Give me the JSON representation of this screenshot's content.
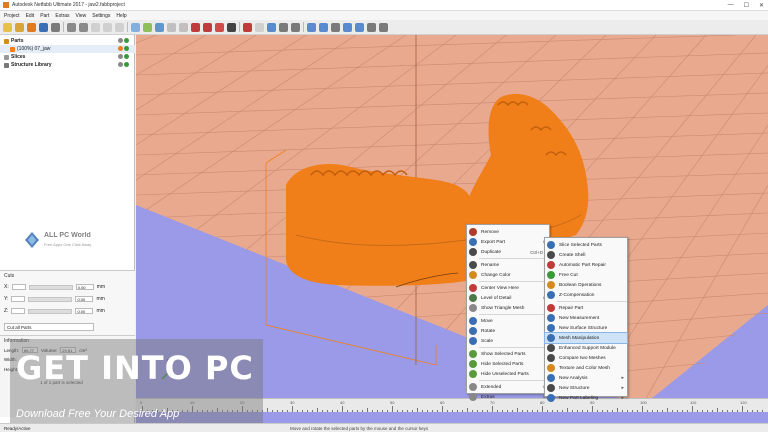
{
  "window": {
    "title": "Autodesk Netfabb Ultimate 2017 - jaw2.fabbproject",
    "controls": [
      "—",
      "☐",
      "✕"
    ]
  },
  "menu": [
    "Project",
    "Edit",
    "Part",
    "Extras",
    "View",
    "Settings",
    "Help"
  ],
  "tree": {
    "rows": [
      {
        "label": "Parts",
        "bold": true
      },
      {
        "label": "(100%) 07_jaw",
        "bold": false
      },
      {
        "label": "Slices",
        "bold": true
      },
      {
        "label": "Structure Library",
        "bold": true
      }
    ]
  },
  "logo": {
    "line1": "ALL PC World",
    "line2": "Free Apps One Click Away"
  },
  "cuts": {
    "header": "Cuts",
    "axes": [
      {
        "axis": "X:",
        "value": "0.00",
        "unit": "mm"
      },
      {
        "axis": "Y:",
        "value": "0.00",
        "unit": "mm"
      },
      {
        "axis": "Z:",
        "value": "0.00",
        "unit": "mm"
      }
    ],
    "select": "Cut all Parts"
  },
  "info": {
    "header": "Information",
    "rows": [
      {
        "label": "Length:",
        "value": "66.77",
        "label2": "Volume:",
        "value2": "29.51",
        "unit2": "cm³"
      },
      {
        "label": "Width:",
        "value": "",
        "label2": "",
        "value2": "",
        "unit2": ""
      },
      {
        "label": "Height:",
        "value": "",
        "label2": "",
        "value2": "",
        "unit2": ""
      }
    ],
    "status": "1 of 1 part is selected"
  },
  "ruler": {
    "labels": [
      "0",
      "10",
      "20",
      "30",
      "40",
      "50",
      "60",
      "70",
      "80",
      "90",
      "100",
      "110",
      "120"
    ]
  },
  "statusbar": {
    "left": "Ready/Active",
    "message": "Move and rotate the selected parts by the mouse and the cursor keys"
  },
  "context_menu": {
    "items": [
      {
        "label": "Remove",
        "shortcut": "",
        "submenu": false,
        "icon_color": "#b33a2a"
      },
      {
        "label": "Export Part",
        "shortcut": "",
        "submenu": true,
        "icon_color": "#3a6fb3"
      },
      {
        "label": "Duplicate",
        "shortcut": "Ctrl+D",
        "submenu": false,
        "icon_color": "#4a4a4a"
      },
      {
        "label": "Rename",
        "shortcut": "",
        "submenu": false,
        "icon_color": "#4a4a4a"
      },
      {
        "label": "Change Color",
        "shortcut": "",
        "submenu": false,
        "icon_color": "#d48a1f"
      },
      {
        "label": "Center View Here",
        "shortcut": "",
        "submenu": false,
        "icon_color": "#c23b3b"
      },
      {
        "label": "Level of Detail",
        "shortcut": "",
        "submenu": true,
        "icon_color": "#4a7a4a"
      },
      {
        "label": "Show Triangle Mesh",
        "shortcut": "",
        "submenu": false,
        "icon_color": "#888888"
      },
      {
        "label": "Move",
        "shortcut": "",
        "submenu": false,
        "icon_color": "#3a6fb3"
      },
      {
        "label": "Rotate",
        "shortcut": "",
        "submenu": false,
        "icon_color": "#3a6fb3"
      },
      {
        "label": "Scale",
        "shortcut": "",
        "submenu": false,
        "icon_color": "#3a6fb3"
      },
      {
        "label": "Show Selected Parts",
        "shortcut": "",
        "submenu": false,
        "icon_color": "#5a9a3a"
      },
      {
        "label": "Hide Selected Parts",
        "shortcut": "",
        "submenu": false,
        "icon_color": "#5a9a3a"
      },
      {
        "label": "Hide Unselected Parts",
        "shortcut": "",
        "submenu": false,
        "icon_color": "#5a9a3a"
      },
      {
        "label": "Extended",
        "shortcut": "",
        "submenu": true,
        "icon_color": "#888888"
      },
      {
        "label": "Extras",
        "shortcut": "",
        "submenu": true,
        "icon_color": "#888888"
      }
    ]
  },
  "sub_menu": {
    "items": [
      {
        "label": "Slice Selected Parts",
        "submenu": false,
        "icon_color": "#3a6fb3"
      },
      {
        "label": "Create Shell",
        "submenu": false,
        "icon_color": "#4a4a4a"
      },
      {
        "label": "Automatic Part Repair",
        "submenu": false,
        "icon_color": "#c23b3b"
      },
      {
        "label": "Free Cut",
        "submenu": false,
        "icon_color": "#3a9a3a"
      },
      {
        "label": "Boolean Operations",
        "submenu": false,
        "icon_color": "#d48a1f"
      },
      {
        "label": "Z-Compensation",
        "submenu": false,
        "icon_color": "#3a6fb3"
      },
      {
        "label": "Repair Part",
        "submenu": false,
        "icon_color": "#c23b3b"
      },
      {
        "label": "New Measurement",
        "submenu": false,
        "icon_color": "#3a6fb3"
      },
      {
        "label": "New Surface Structure",
        "submenu": false,
        "icon_color": "#3a6fb3"
      },
      {
        "label": "Mesh Manipulation",
        "submenu": false,
        "icon_color": "#3a6fb3",
        "highlighted": true
      },
      {
        "label": "Enhanced Support Module",
        "submenu": false,
        "icon_color": "#4a4a4a"
      },
      {
        "label": "Compare two Meshes",
        "submenu": false,
        "icon_color": "#4a4a4a"
      },
      {
        "label": "Texture and Color Mesh",
        "submenu": false,
        "icon_color": "#d48a1f"
      },
      {
        "label": "New Analysis",
        "submenu": true,
        "icon_color": "#3a6fb3"
      },
      {
        "label": "New Structure",
        "submenu": true,
        "icon_color": "#4a4a4a"
      },
      {
        "label": "New Part Labeling",
        "submenu": true,
        "icon_color": "#3a6fb3"
      }
    ]
  },
  "watermark": {
    "big_a": "GET",
    "big_b": "INTO",
    "big_c": "PC",
    "small": "Download Free Your Desired App"
  },
  "colors": {
    "model": "#f07f1a",
    "platform": "#e8a98e",
    "background": "#9a9ae8",
    "highlight": "#cfe3f8"
  }
}
